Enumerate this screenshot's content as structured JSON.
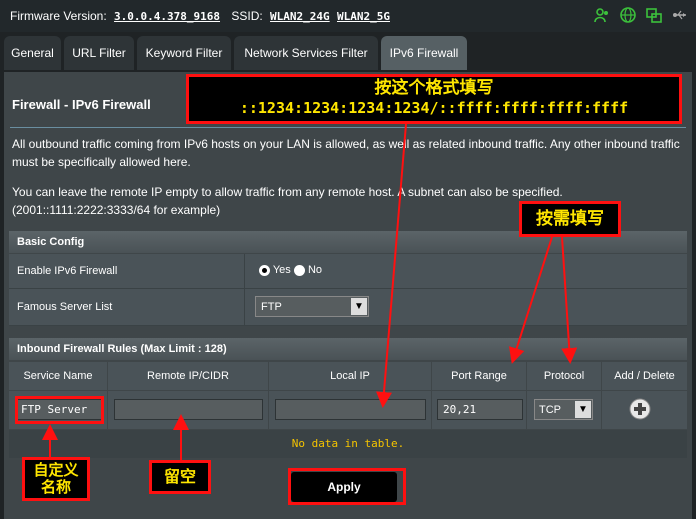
{
  "header": {
    "firmware_label": "Firmware Version:",
    "firmware_version": "3.0.0.4.378_9168",
    "ssid_label": "SSID:",
    "ssid_24": "WLAN2_24G",
    "ssid_5": "WLAN2_5G"
  },
  "tabs": [
    {
      "label": "General"
    },
    {
      "label": "URL Filter"
    },
    {
      "label": "Keyword Filter"
    },
    {
      "label": "Network Services Filter"
    },
    {
      "label": "IPv6 Firewall"
    }
  ],
  "page": {
    "title": "Firewall - IPv6 Firewall",
    "desc1": "All outbound traffic coming from IPv6 hosts on your LAN is allowed, as well as related inbound traffic. Any other inbound traffic must be specifically allowed here.",
    "desc2": "You can leave the remote IP empty to allow traffic from any remote host. A subnet can also be specified. (2001::1111:2222:3333/64 for example)"
  },
  "basic_config": {
    "header": "Basic Config",
    "enable_label": "Enable IPv6 Firewall",
    "yes": "Yes",
    "no": "No",
    "famous_label": "Famous Server List",
    "famous_value": "FTP"
  },
  "rules": {
    "header": "Inbound Firewall Rules (Max Limit : 128)",
    "columns": [
      "Service Name",
      "Remote IP/CIDR",
      "Local IP",
      "Port Range",
      "Protocol",
      "Add / Delete"
    ],
    "service_name": "FTP Server",
    "remote_ip": "",
    "local_ip": "",
    "port_range": "20,21",
    "protocol": "TCP",
    "empty": "No data in table."
  },
  "apply_label": "Apply",
  "annotations": {
    "format_title": "按这个格式填写",
    "format_example": "::1234:1234:1234:1234/::ffff:ffff:ffff:ffff",
    "as_needed": "按需填写",
    "custom_name": "自定义名称",
    "leave_empty": "留空"
  },
  "colors": {
    "annotation_red": "#ff1010",
    "annotation_yellow": "#ffe600",
    "nodata_yellow": "#f5c400",
    "icon_green": "#3cc13c"
  }
}
